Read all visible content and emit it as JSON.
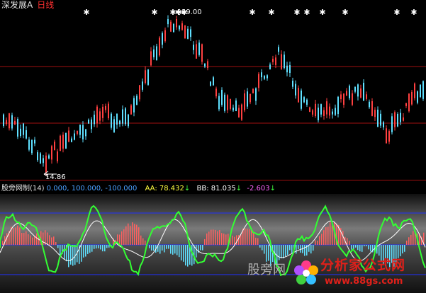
{
  "window": {
    "stock_name": "深发展A",
    "period": "日线"
  },
  "main_chart": {
    "high_label": "19.00",
    "low_label": "14.86"
  },
  "indicator": {
    "name": "股旁网制",
    "param": "(14)",
    "levels_text": "0.000, 100.000, -100.000",
    "aa_label": "AA:",
    "aa_value": "78.432",
    "bb_label": "BB:",
    "bb_value": "81.035",
    "bb_value2": "-2.603",
    "arrow": "↓"
  },
  "watermark": {
    "text": "股旁网",
    "brand_name": "分析家公式网",
    "brand_url": "www.88gs.com"
  },
  "colors": {
    "up": "#ff4040",
    "down": "#5fe0ff",
    "level_blue": "#2030ff",
    "level_red": "#a01010",
    "main_line": "#33ff33",
    "sub_line": "#ffffff"
  }
}
